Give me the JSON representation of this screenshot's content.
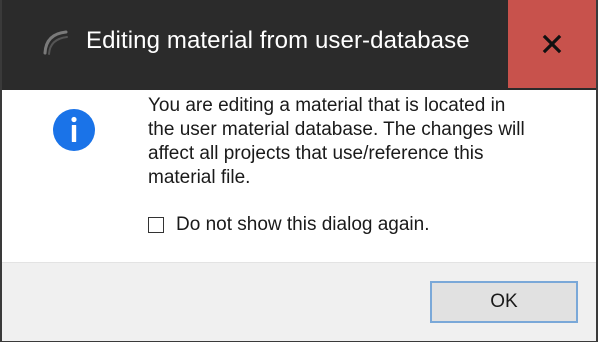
{
  "titlebar": {
    "title": "Editing material from user-database",
    "app_icon": "app-arc-icon",
    "close_icon": "close-icon",
    "close_color": "#c8524c"
  },
  "body": {
    "info_icon": "info-icon",
    "info_color": "#1a73e8",
    "message_lines": [
      "You are editing a material that is located in",
      "the user material database. The changes will",
      "affect all projects that use/reference this",
      "material file."
    ],
    "checkbox": {
      "label": "Do not show this dialog again.",
      "checked": false
    }
  },
  "footer": {
    "ok_label": "OK"
  }
}
